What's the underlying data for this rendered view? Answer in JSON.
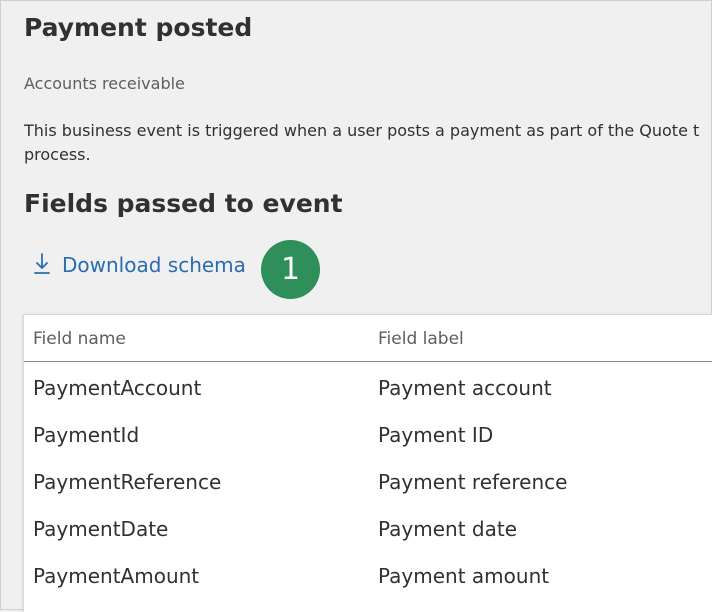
{
  "page": {
    "title": "Payment posted",
    "subtitle": "Accounts receivable",
    "description_line1": "This business event is triggered when a user posts a payment as part of the Quote t",
    "description_line2": "process.",
    "section_title": "Fields passed to event",
    "download_label": "Download schema",
    "badge_number": "1"
  },
  "table": {
    "headers": [
      "Field name",
      "Field label"
    ],
    "rows": [
      [
        "PaymentAccount",
        "Payment account"
      ],
      [
        "PaymentId",
        "Payment ID"
      ],
      [
        "PaymentReference",
        "Payment reference"
      ],
      [
        "PaymentDate",
        "Payment date"
      ],
      [
        "PaymentAmount",
        "Payment amount"
      ]
    ]
  },
  "colors": {
    "background": "#f0f0f0",
    "link": "#2b6cb0",
    "badge": "#2f8f5a",
    "text_primary": "#323130",
    "text_secondary": "#605e5c"
  },
  "icons": {
    "download": "download-icon"
  }
}
